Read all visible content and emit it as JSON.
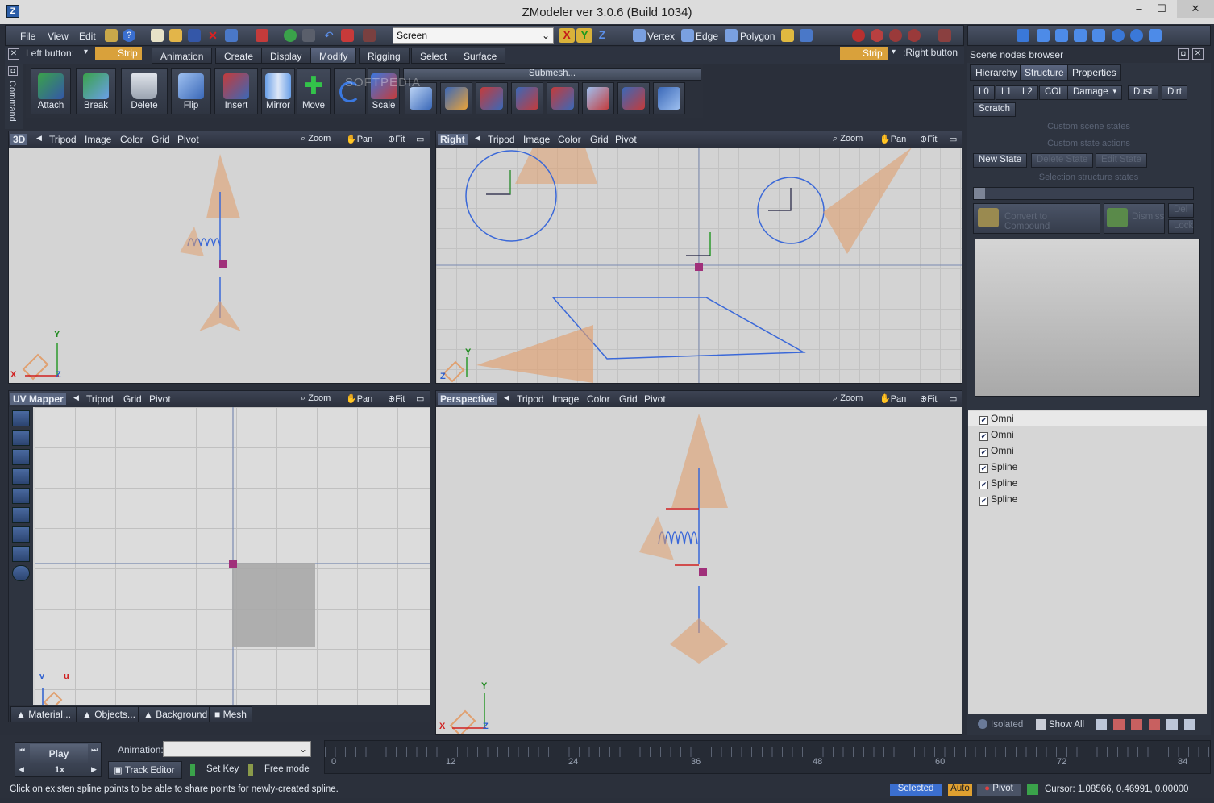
{
  "window": {
    "title": "ZModeler ver 3.0.6 (Build 1034)",
    "min": "–",
    "max": "☐",
    "close": "✕"
  },
  "menu": [
    "File",
    "View",
    "Edit"
  ],
  "toolbar": {
    "screen_combo": "Screen",
    "axis_x": "X",
    "axis_y": "Y",
    "axis_z": "Z",
    "vertex": "Vertex",
    "edge": "Edge",
    "polygon": "Polygon"
  },
  "left_button": {
    "label": "Left button:",
    "mode": "Strip"
  },
  "right_button": {
    "mode": "Strip",
    "label": ":Right button"
  },
  "mode_tabs": [
    "Animation",
    "Create",
    "Display",
    "Modify",
    "Rigging",
    "Select",
    "Surface"
  ],
  "commands": [
    "Attach",
    "Break",
    "Delete",
    "Flip",
    "Insert",
    "Mirror",
    "Move",
    "Scale"
  ],
  "submesh_label": "Submesh...",
  "command_sidebar": "Command",
  "viewport_3d": {
    "name": "3D",
    "items": [
      "Tripod",
      "Image",
      "Color",
      "Grid",
      "Pivot"
    ],
    "zoom": "Zoom",
    "pan": "Pan",
    "fit": "Fit"
  },
  "viewport_right": {
    "name": "Right",
    "items": [
      "Tripod",
      "Image",
      "Color",
      "Grid",
      "Pivot"
    ],
    "zoom": "Zoom",
    "pan": "Pan",
    "fit": "Fit"
  },
  "viewport_uv": {
    "name": "UV Mapper",
    "items": [
      "Tripod",
      "Grid",
      "Pivot"
    ],
    "zoom": "Zoom",
    "pan": "Pan",
    "fit": "Fit",
    "bottom_tabs": [
      "Material...",
      "Objects...",
      "Background",
      "Mesh"
    ]
  },
  "viewport_persp": {
    "name": "Perspective",
    "items": [
      "Tripod",
      "Image",
      "Color",
      "Grid",
      "Pivot"
    ],
    "zoom": "Zoom",
    "pan": "Pan",
    "fit": "Fit"
  },
  "axes": {
    "x": "X",
    "y": "Y",
    "z": "Z",
    "u": "u",
    "v": "v"
  },
  "scene_browser": {
    "title": "Scene nodes browser",
    "tabs": [
      "Hierarchy",
      "Structure",
      "Properties"
    ],
    "lod_buttons": [
      "L0",
      "L1",
      "L2",
      "COL",
      "Damage",
      "Dust",
      "Dirt",
      "Scratch"
    ],
    "custom_scene_states": "Custom scene states",
    "custom_state_actions": "Custom state actions",
    "new_state": "New State",
    "delete_state": "Delete State",
    "edit_state": "Edit State",
    "selection_structure_states": "Selection structure states",
    "convert": "Convert to Compound",
    "dismiss": "Dismiss",
    "del": "Del",
    "lock": "Lock",
    "nodes": [
      "Omni",
      "Omni",
      "Omni",
      "Spline",
      "Spline",
      "Spline"
    ],
    "footer": {
      "isolated": "Isolated",
      "show_all": "Show All"
    }
  },
  "timeline": {
    "play": "Play",
    "speed": "1x",
    "animation_label": "Animation:",
    "track_editor": "Track Editor",
    "set_key": "Set Key",
    "free_mode": "Free mode",
    "ticks": [
      "0",
      "12",
      "24",
      "36",
      "48",
      "60",
      "72",
      "84"
    ]
  },
  "status": {
    "hint": "Click on existen spline points to be able to share points for newly-created spline.",
    "selected": "Selected",
    "auto": "Auto",
    "pivot": "Pivot",
    "cursor": "Cursor: 1.08566, 0.46991, 0.00000"
  },
  "watermark": "SOFTPEDIA"
}
